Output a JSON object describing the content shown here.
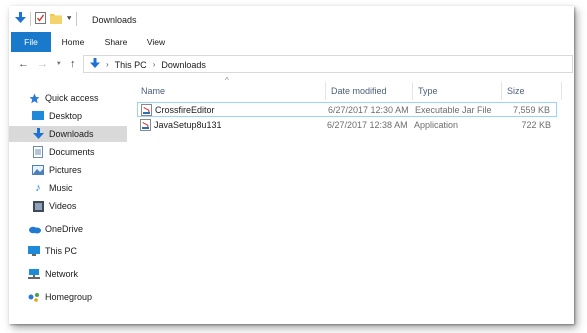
{
  "window": {
    "title": "Downloads"
  },
  "ribbon": {
    "tabs": [
      "File",
      "Home",
      "Share",
      "View"
    ]
  },
  "address": {
    "crumbs": [
      "This PC",
      "Downloads"
    ]
  },
  "sidebar": {
    "items": [
      {
        "label": "Quick access",
        "icon": "star-icon",
        "pinned": false
      },
      {
        "label": "Desktop",
        "icon": "desktop-icon",
        "pinned": true
      },
      {
        "label": "Downloads",
        "icon": "download-arrow-icon",
        "pinned": true,
        "selected": true
      },
      {
        "label": "Documents",
        "icon": "document-icon",
        "pinned": true
      },
      {
        "label": "Pictures",
        "icon": "picture-icon",
        "pinned": true
      },
      {
        "label": "Music",
        "icon": "music-note-icon",
        "pinned": false
      },
      {
        "label": "Videos",
        "icon": "video-icon",
        "pinned": false
      },
      {
        "label": "OneDrive",
        "icon": "cloud-icon",
        "pinned": false
      },
      {
        "label": "This PC",
        "icon": "computer-icon",
        "pinned": false
      },
      {
        "label": "Network",
        "icon": "network-icon",
        "pinned": false
      },
      {
        "label": "Homegroup",
        "icon": "homegroup-icon",
        "pinned": false
      }
    ]
  },
  "files": {
    "columns": [
      "Name",
      "Date modified",
      "Type",
      "Size"
    ],
    "rows": [
      {
        "name": "CrossfireEditor",
        "date": "6/27/2017 12:30 AM",
        "type": "Executable Jar File",
        "size": "7,559 KB",
        "icon": "jar-file-icon",
        "selected": true
      },
      {
        "name": "JavaSetup8u131",
        "date": "6/27/2017 12:38 AM",
        "type": "Application",
        "size": "722 KB",
        "icon": "application-icon",
        "selected": false
      }
    ]
  },
  "colors": {
    "file_tab": "#1979ca",
    "selected_sidebar": "#d9d9d9",
    "selected_row_border": "#99d1ff",
    "header_text": "#4c607a"
  }
}
